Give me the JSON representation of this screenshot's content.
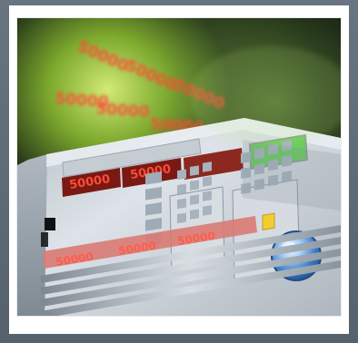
{
  "photo": {
    "alt": "Electronic load instrument with glowing LED displays and keypad",
    "floating_numbers": [
      "50000",
      "50000",
      "50000",
      "50000",
      "50000",
      "50000"
    ],
    "instrument": {
      "front_display_values": [
        "50000",
        "50000"
      ],
      "lower_display_values": [
        "50000",
        "50000",
        "50000"
      ]
    },
    "colors": {
      "background_dark": "#0d1610",
      "glow_green": "#a6d23f",
      "instrument_body": "#cfd6dc",
      "led_red": "#ff3f2f",
      "lcd_green": "#69c95c",
      "knob_blue": "#3d7cc8",
      "key_yellow": "#f2cd2f"
    }
  }
}
